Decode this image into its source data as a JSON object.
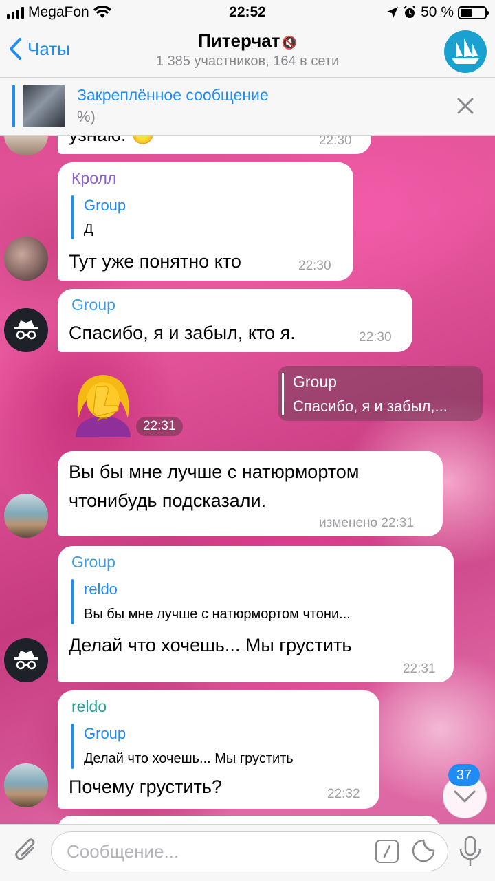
{
  "status_bar": {
    "carrier": "MegaFon",
    "time": "22:52",
    "battery": "50 %",
    "battery_level": 0.5
  },
  "header": {
    "back_label": "Чаты",
    "title": "Питерчат",
    "subtitle": "1 385 участников, 164 в сети"
  },
  "pinned": {
    "title": "Закреплённое сообщение",
    "text": "%)"
  },
  "messages": [
    {
      "text": "узнаю. 😶",
      "time": "22:30"
    },
    {
      "sender": "Кролл",
      "reply_name": "Group",
      "reply_text": "Д",
      "text": "Тут уже понятно кто",
      "time": "22:30"
    },
    {
      "sender": "Group",
      "text": "Спасибо, я и забыл, кто я.",
      "time": "22:30"
    },
    {
      "sticker": "🤦‍♀️",
      "time": "22:31",
      "reply_name": "Group",
      "reply_text": "Спасибо, я и забыл,..."
    },
    {
      "text_line1": "Вы бы мне лучше с натюрмортом",
      "text_line2": "чтонибудь подсказали.",
      "time": "изменено 22:31"
    },
    {
      "sender": "Group",
      "reply_name": "reldo",
      "reply_text": "Вы бы мне лучше с натюрмортом чтони...",
      "text": "Делай что хочешь... Мы грустить",
      "time": "22:31"
    },
    {
      "sender": "reldo",
      "reply_name": "Group",
      "reply_text": "Делай что хочешь... Мы грустить",
      "text": "Почему грустить?",
      "time": "22:32"
    }
  ],
  "scroll": {
    "unread_count": "37"
  },
  "input": {
    "placeholder": "Сообщение..."
  },
  "colors": {
    "accent": "#1f8cf5",
    "sender_kroll": "#8e5fd3",
    "sender_group": "#3c9be2",
    "sender_reldo": "#2aa197"
  }
}
